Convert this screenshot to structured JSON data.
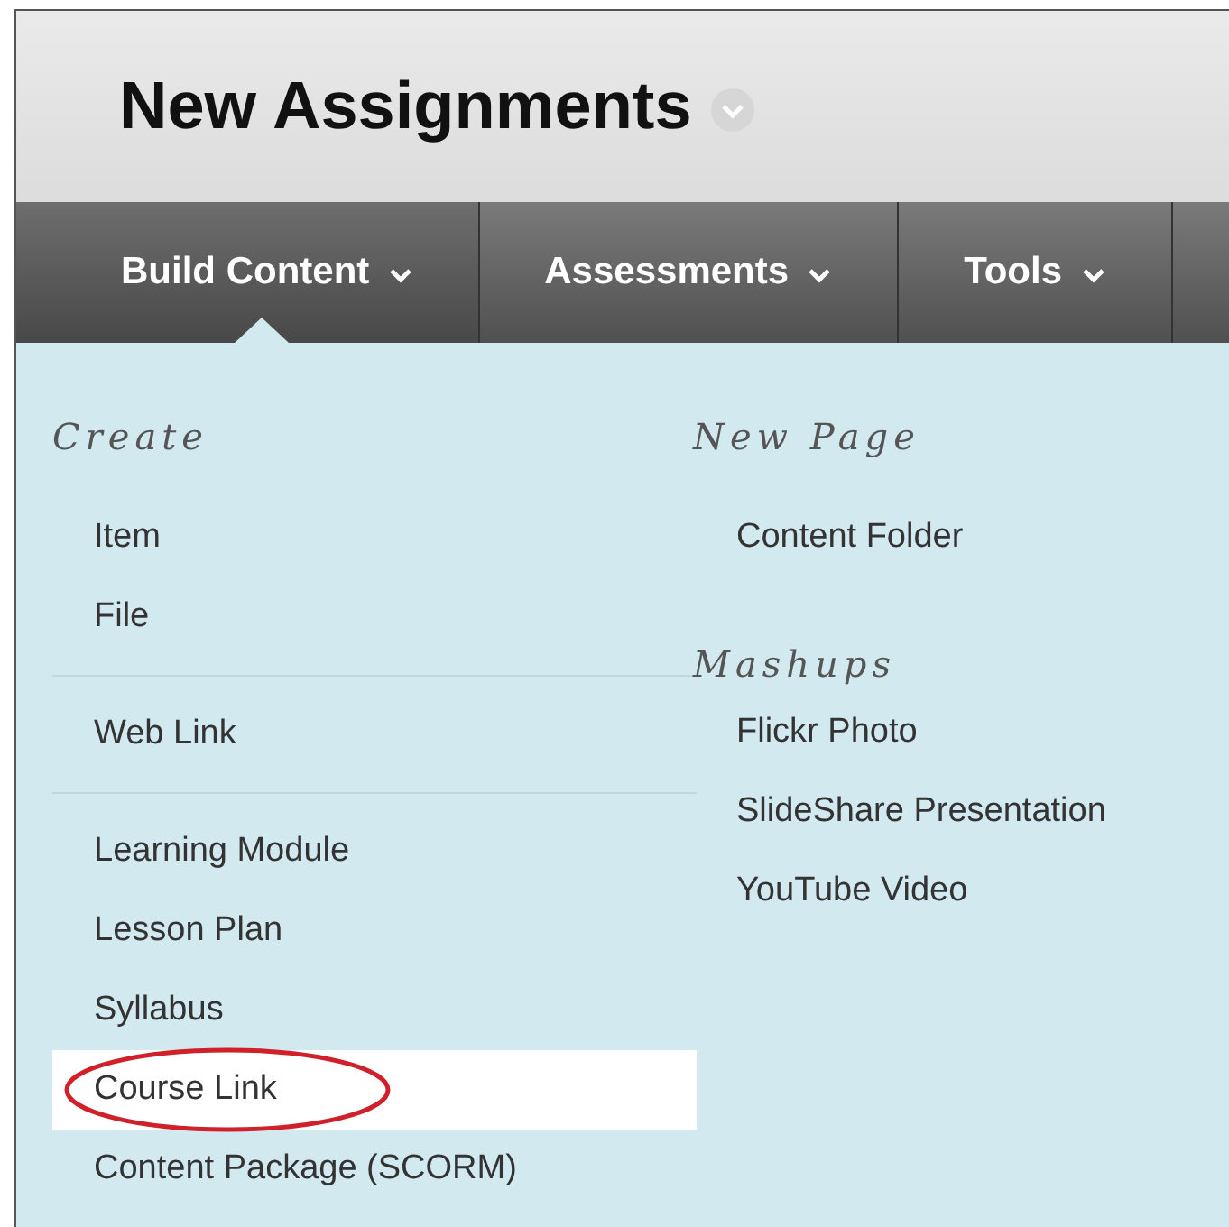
{
  "page_title": "New Assignments",
  "tabs": [
    {
      "label": "Build Content",
      "selected": true
    },
    {
      "label": "Assessments",
      "selected": false
    },
    {
      "label": "Tools",
      "selected": false
    }
  ],
  "menu": {
    "left": {
      "heading": "Create",
      "groups": [
        [
          {
            "label": "Item",
            "selected": false
          },
          {
            "label": "File",
            "selected": false
          }
        ],
        [
          {
            "label": "Web Link",
            "selected": false
          }
        ],
        [
          {
            "label": "Learning Module",
            "selected": false
          },
          {
            "label": "Lesson Plan",
            "selected": false
          },
          {
            "label": "Syllabus",
            "selected": false
          },
          {
            "label": "Course Link",
            "selected": true
          },
          {
            "label": "Content Package (SCORM)",
            "selected": false
          }
        ]
      ]
    },
    "right": [
      {
        "heading": "New Page",
        "items": [
          {
            "label": "Content Folder",
            "selected": false
          }
        ]
      },
      {
        "heading": "Mashups",
        "items": [
          {
            "label": "Flickr Photo",
            "selected": false
          },
          {
            "label": "SlideShare Presentation",
            "selected": false
          },
          {
            "label": "YouTube Video",
            "selected": false
          }
        ]
      }
    ]
  }
}
